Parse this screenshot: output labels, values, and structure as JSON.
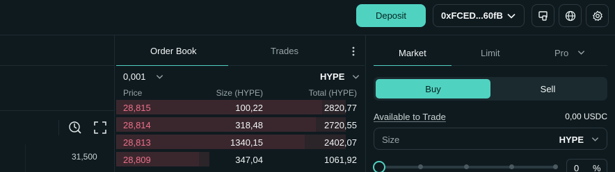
{
  "header": {
    "deposit_label": "Deposit",
    "wallet_label": "0xFCED...60fB",
    "icons": [
      "device-icon",
      "globe-icon",
      "gear-icon"
    ]
  },
  "chart": {
    "price_label": "31,500",
    "icons": [
      "indicator-icon",
      "fullscreen-icon"
    ]
  },
  "order_book": {
    "tabs": [
      "Order Book",
      "Trades"
    ],
    "tick_size": "0,001",
    "asset": "HYPE",
    "columns": [
      "Price",
      "Size (HYPE)",
      "Total (HYPE)"
    ],
    "rows": [
      {
        "price": "28,815",
        "size": "100,22",
        "total": "2820,77",
        "depth": 0.92
      },
      {
        "price": "28,814",
        "size": "318,48",
        "total": "2720,55",
        "depth": 0.89
      },
      {
        "price": "28,813",
        "size": "1340,15",
        "total": "2402,07",
        "depth": 0.84
      },
      {
        "price": "28,809",
        "size": "347,04",
        "total": "1061,92",
        "depth": 0.37
      }
    ]
  },
  "trade_panel": {
    "tabs": [
      "Market",
      "Limit",
      "Pro"
    ],
    "buy_label": "Buy",
    "sell_label": "Sell",
    "available_label": "Available to Trade",
    "available_value": "0,00 USDC",
    "size_label": "Size",
    "size_unit": "HYPE",
    "percent_value": "0",
    "percent_sign": "%"
  },
  "colors": {
    "accent": "#50d2c1",
    "ask": "#ed7088",
    "background": "#0f1a1f"
  }
}
